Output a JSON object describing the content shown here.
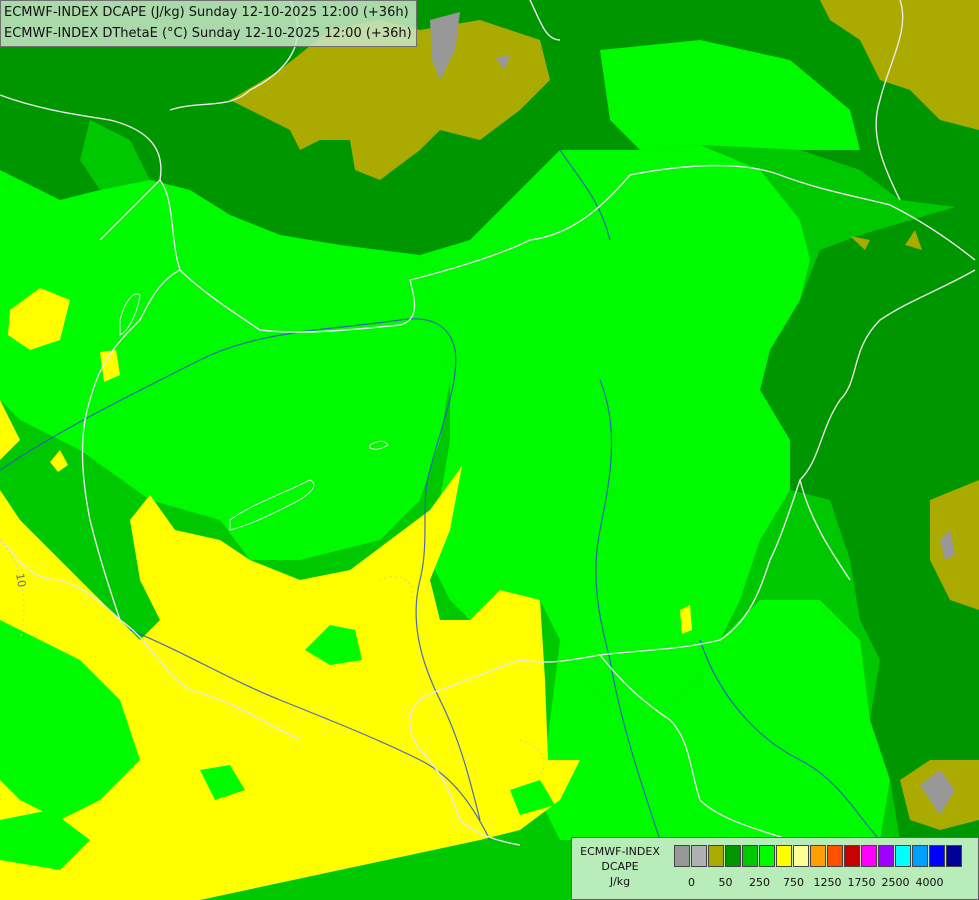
{
  "title": {
    "line1": "ECMWF-INDEX DCAPE (J/kg) Sunday 12-10-2025 12:00 (+36h)",
    "line2": "ECMWF-INDEX DThetaE (°C) Sunday 12-10-2025 12:00 (+36h)"
  },
  "map_labels": {
    "contour_label": "10"
  },
  "legend": {
    "line1": "ECMWF-INDEX",
    "line2": "DCAPE",
    "unit": "J/kg",
    "colors": [
      "#989898",
      "#b0b0b0",
      "#aaaa00",
      "#009600",
      "#00c800",
      "#00fa00",
      "#ffff00",
      "#ffff96",
      "#ffa000",
      "#ff5000",
      "#c80000",
      "#ff00ff",
      "#a000ff",
      "#00ffff",
      "#00a0ff",
      "#0000ff",
      "#000096"
    ],
    "ticks": [
      "0",
      "50",
      "250",
      "750",
      "1250",
      "1750",
      "2500",
      "4000"
    ]
  },
  "colors": {
    "dark_green": "#009600",
    "green": "#00c800",
    "light_green": "#00fa00",
    "yellow": "#ffff00",
    "olive": "#aaaa00",
    "gray": "#989898",
    "border": "#e0e0e0",
    "river": "#3050d0"
  }
}
